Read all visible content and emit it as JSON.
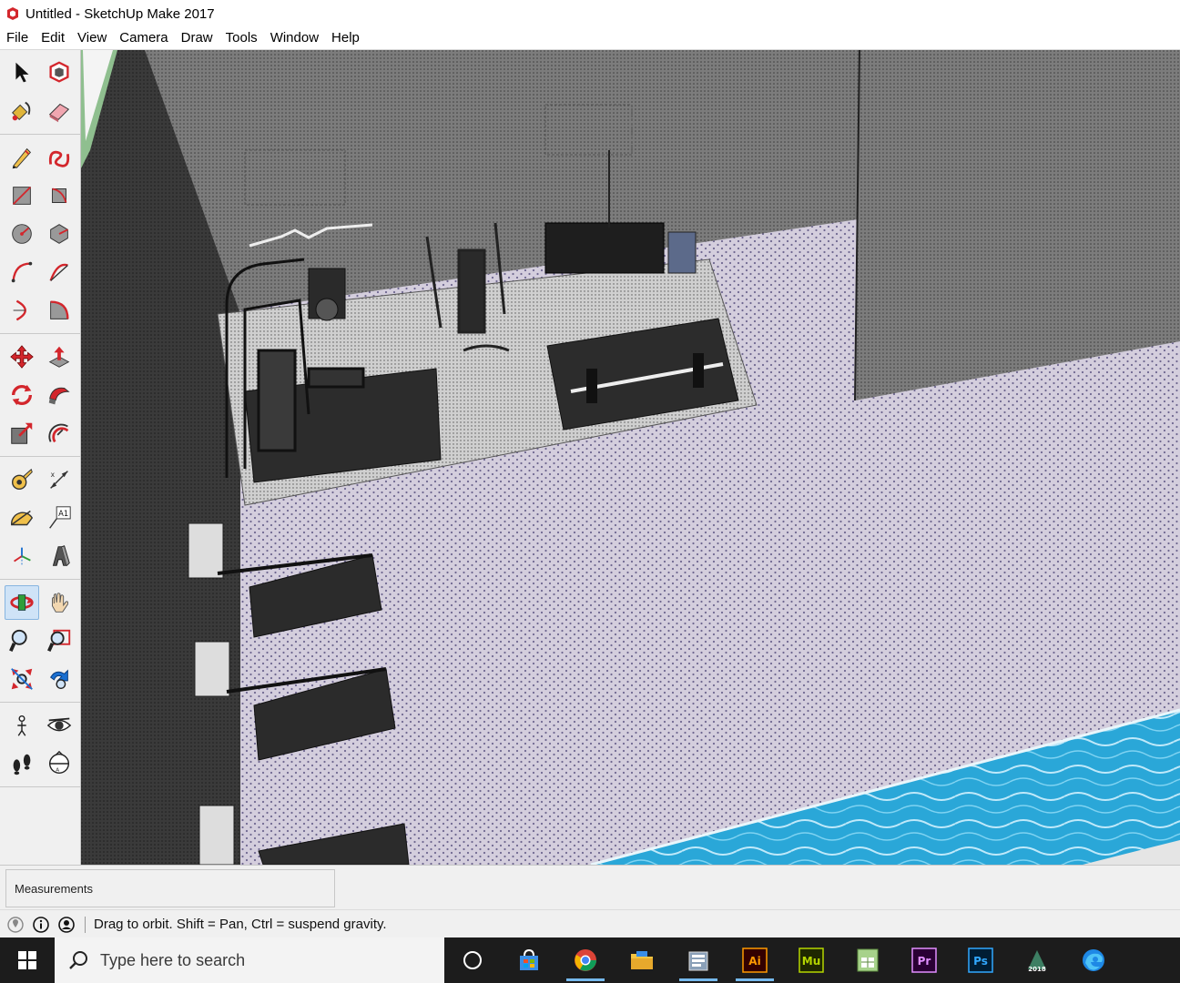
{
  "window": {
    "title": "Untitled - SketchUp Make 2017"
  },
  "menu": [
    "File",
    "Edit",
    "View",
    "Camera",
    "Draw",
    "Tools",
    "Window",
    "Help"
  ],
  "toolbar": {
    "groups": [
      [
        [
          "select-icon",
          "component-icon"
        ],
        [
          "paint-bucket-icon",
          "eraser-icon"
        ]
      ],
      [
        [
          "line-pencil-icon",
          "freehand-icon"
        ],
        [
          "rectangle-icon",
          "rotated-rectangle-icon"
        ],
        [
          "circle-icon",
          "polygon-icon"
        ],
        [
          "arc-icon",
          "two-point-arc-icon"
        ],
        [
          "three-point-arc-icon",
          "pie-icon"
        ]
      ],
      [
        [
          "move-icon",
          "push-pull-icon"
        ],
        [
          "rotate-icon",
          "follow-me-icon"
        ],
        [
          "scale-icon",
          "offset-icon"
        ]
      ],
      [
        [
          "tape-measure-icon",
          "dimension-icon"
        ],
        [
          "protractor-icon",
          "text-icon"
        ],
        [
          "axes-icon",
          "3d-text-icon"
        ]
      ],
      [
        [
          "orbit-icon",
          "pan-icon"
        ],
        [
          "zoom-icon",
          "zoom-window-icon"
        ],
        [
          "zoom-extents-icon",
          "previous-view-icon"
        ]
      ],
      [
        [
          "position-camera-icon",
          "look-around-icon"
        ],
        [
          "walk-icon",
          "section-plane-icon"
        ]
      ]
    ],
    "active_tool": "orbit-icon",
    "text_tool_label": "A1"
  },
  "measurements": {
    "label": "Measurements",
    "value": ""
  },
  "status": {
    "message": "Drag to orbit. Shift = Pan, Ctrl = suspend gravity."
  },
  "taskbar": {
    "search_placeholder": "Type here to search",
    "apps": [
      {
        "name": "task-view-icon",
        "label": ""
      },
      {
        "name": "store-icon",
        "label": ""
      },
      {
        "name": "chrome-icon",
        "label": ""
      },
      {
        "name": "file-explorer-icon",
        "label": ""
      },
      {
        "name": "app-icon",
        "label": ""
      },
      {
        "name": "illustrator-icon",
        "label": "Ai"
      },
      {
        "name": "muse-icon",
        "label": "Mu"
      },
      {
        "name": "spreadsheet-icon",
        "label": ""
      },
      {
        "name": "premiere-icon",
        "label": "Pr"
      },
      {
        "name": "photoshop-icon",
        "label": "Ps"
      },
      {
        "name": "autodesk-icon",
        "label": "2018"
      },
      {
        "name": "edge-icon",
        "label": ""
      }
    ]
  },
  "colors": {
    "sketchup_red": "#d3262c",
    "selected_tool": "#cfe3f7",
    "pool_water": "#2aa7d8",
    "floor_tile": "#cfc8d8",
    "wall_dark": "#3a3a3a"
  }
}
